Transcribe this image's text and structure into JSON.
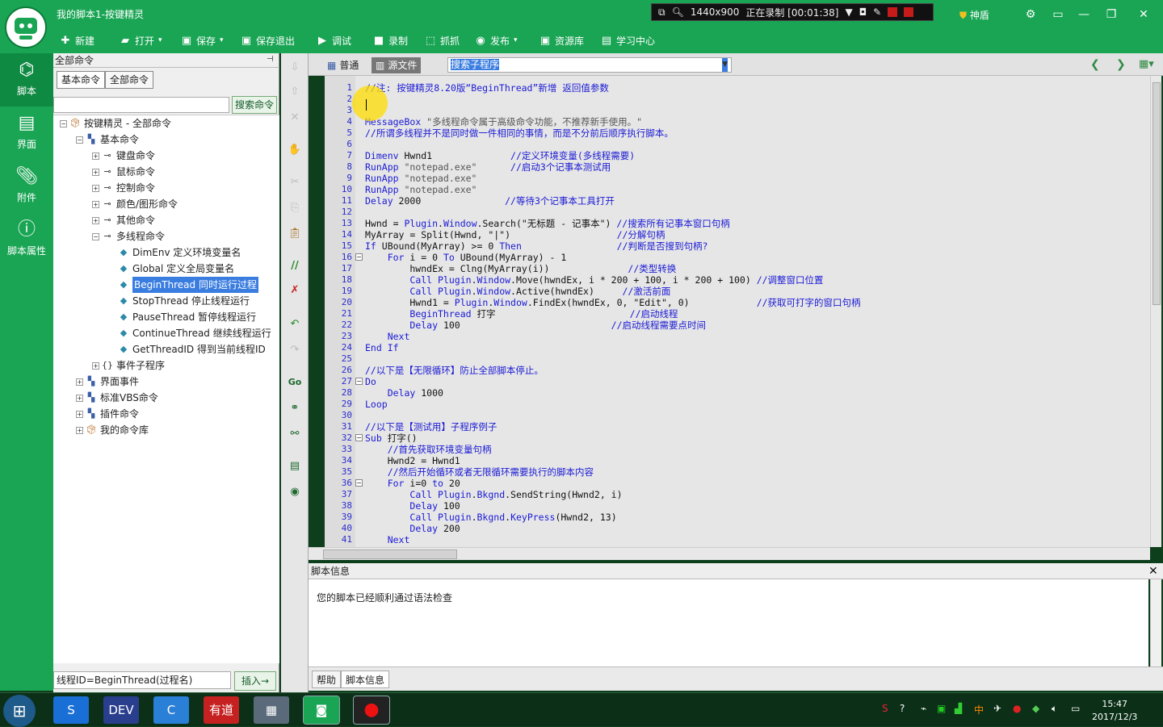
{
  "window": {
    "title": "我的脚本1-按键精灵"
  },
  "toolbar": [
    {
      "label": "新建",
      "icon": "plus-icon"
    },
    {
      "label": "打开",
      "icon": "folder-icon"
    },
    {
      "label": "保存",
      "icon": "save-icon"
    },
    {
      "label": "保存退出",
      "icon": "save-exit-icon"
    },
    {
      "label": "调试",
      "icon": "play-icon"
    },
    {
      "label": "录制",
      "icon": "camera-icon"
    },
    {
      "label": "抓抓",
      "icon": "grab-icon"
    },
    {
      "label": "发布",
      "icon": "publish-icon"
    },
    {
      "label": "资源库",
      "icon": "library-icon"
    },
    {
      "label": "学习中心",
      "icon": "book-icon"
    }
  ],
  "recorder": {
    "size": "1440x900",
    "status": "正在录制 [00:01:38]"
  },
  "shield": {
    "label": "神盾"
  },
  "leftbar": [
    {
      "label": "脚本",
      "icon": "script-icon"
    },
    {
      "label": "界面",
      "icon": "ui-icon"
    },
    {
      "label": "附件",
      "icon": "attachment-icon"
    },
    {
      "label": "脚本属性",
      "icon": "info-icon"
    }
  ],
  "panel": {
    "title": "全部命令",
    "tabs": [
      "基本命令",
      "全部命令"
    ],
    "search_button": "搜索命令",
    "tree": [
      {
        "label": "按键精灵 - 全部命令",
        "level": 0,
        "exp": "-",
        "icon": "root"
      },
      {
        "label": "基本命令",
        "level": 1,
        "exp": "-",
        "icon": "group"
      },
      {
        "label": "键盘命令",
        "level": 2,
        "exp": "+",
        "icon": "link"
      },
      {
        "label": "鼠标命令",
        "level": 2,
        "exp": "+",
        "icon": "link"
      },
      {
        "label": "控制命令",
        "level": 2,
        "exp": "+",
        "icon": "link"
      },
      {
        "label": "颜色/图形命令",
        "level": 2,
        "exp": "+",
        "icon": "link"
      },
      {
        "label": "其他命令",
        "level": 2,
        "exp": "+",
        "icon": "link"
      },
      {
        "label": "多线程命令",
        "level": 2,
        "exp": "-",
        "icon": "link"
      },
      {
        "label": "DimEnv 定义环境变量名",
        "level": 3,
        "icon": "gem"
      },
      {
        "label": "Global 定义全局变量名",
        "level": 3,
        "icon": "gem"
      },
      {
        "label": "BeginThread 同时运行过程",
        "level": 3,
        "icon": "gem",
        "selected": true
      },
      {
        "label": "StopThread 停止线程运行",
        "level": 3,
        "icon": "gem"
      },
      {
        "label": "PauseThread 暂停线程运行",
        "level": 3,
        "icon": "gem"
      },
      {
        "label": "ContinueThread 继续线程运行",
        "level": 3,
        "icon": "gem"
      },
      {
        "label": "GetThreadID 得到当前线程ID",
        "level": 3,
        "icon": "gem"
      },
      {
        "label": "事件子程序",
        "level": 2,
        "exp": "+",
        "icon": "brace"
      },
      {
        "label": "界面事件",
        "level": 1,
        "exp": "+",
        "icon": "group"
      },
      {
        "label": "标准VBS命令",
        "level": 1,
        "exp": "+",
        "icon": "group"
      },
      {
        "label": "插件命令",
        "level": 1,
        "exp": "+",
        "icon": "group"
      },
      {
        "label": "我的命令库",
        "level": 1,
        "exp": "+",
        "icon": "root"
      }
    ],
    "syntax_line": "线程ID=BeginThread(过程名)",
    "insert_button": "插入→"
  },
  "editor": {
    "tabs": [
      "普通",
      "源文件"
    ],
    "sub_search": "搜索子程序",
    "lines": [
      [
        {
          "t": "//注: 按键精灵8.20版“BeginThread”新增 返回值参数",
          "c": "cm"
        }
      ],
      [
        {
          "t": "",
          "c": ""
        }
      ],
      [
        {
          "t": "",
          "c": ""
        }
      ],
      [
        {
          "t": "MessageBox",
          "c": "kw"
        },
        {
          "t": " \"多线程命令属于高级命令功能，不推荐新手使用。\"",
          "c": "st"
        }
      ],
      [
        {
          "t": "//所谓多线程并不是同时做一件相同的事情，而是不分前后顺序执行脚本。",
          "c": "cm"
        }
      ],
      [
        {
          "t": "",
          "c": ""
        }
      ],
      [
        {
          "t": "Dimenv",
          "c": "kw"
        },
        {
          "t": " Hwnd1              ",
          "c": ""
        },
        {
          "t": "//定义环境变量(多线程需要)",
          "c": "cm"
        }
      ],
      [
        {
          "t": "RunApp",
          "c": "kw"
        },
        {
          "t": " \"notepad.exe\"      ",
          "c": "st"
        },
        {
          "t": "//启动3个记事本测试用",
          "c": "cm"
        }
      ],
      [
        {
          "t": "RunApp",
          "c": "kw"
        },
        {
          "t": " \"notepad.exe\"",
          "c": "st"
        }
      ],
      [
        {
          "t": "RunApp",
          "c": "kw"
        },
        {
          "t": " \"notepad.exe\"",
          "c": "st"
        }
      ],
      [
        {
          "t": "Delay",
          "c": "kw"
        },
        {
          "t": " 2000               ",
          "c": ""
        },
        {
          "t": "//等待3个记事本工具打开",
          "c": "cm"
        }
      ],
      [
        {
          "t": "",
          "c": ""
        }
      ],
      [
        {
          "t": "Hwnd = ",
          "c": ""
        },
        {
          "t": "Plugin",
          "c": "kw"
        },
        {
          "t": ".",
          "c": ""
        },
        {
          "t": "Window",
          "c": "kw"
        },
        {
          "t": ".Search(\"无标题 - 记事本\") ",
          "c": ""
        },
        {
          "t": "//搜索所有记事本窗口句柄",
          "c": "cm"
        }
      ],
      [
        {
          "t": "MyArray = Split(Hwnd, \"|\")                   ",
          "c": ""
        },
        {
          "t": "//分解句柄",
          "c": "cm"
        }
      ],
      [
        {
          "t": "If",
          "c": "kw"
        },
        {
          "t": " UBound(MyArray) >= 0 ",
          "c": ""
        },
        {
          "t": "Then",
          "c": "kw"
        },
        {
          "t": "                 ",
          "c": ""
        },
        {
          "t": "//判断是否搜到句柄?",
          "c": "cm"
        }
      ],
      [
        {
          "t": "    ",
          "c": ""
        },
        {
          "t": "For",
          "c": "kw"
        },
        {
          "t": " i = 0 ",
          "c": ""
        },
        {
          "t": "To",
          "c": "kw"
        },
        {
          "t": " UBound(MyArray) - 1",
          "c": ""
        }
      ],
      [
        {
          "t": "        hwndEx = Clng(MyArray(i))              ",
          "c": ""
        },
        {
          "t": "//类型转换",
          "c": "cm"
        }
      ],
      [
        {
          "t": "        ",
          "c": ""
        },
        {
          "t": "Call Plugin",
          "c": "kw"
        },
        {
          "t": ".",
          "c": ""
        },
        {
          "t": "Window",
          "c": "kw"
        },
        {
          "t": ".Move(hwndEx, i * 200 + 100, i * 200 + 100) ",
          "c": ""
        },
        {
          "t": "//调整窗口位置",
          "c": "cm"
        }
      ],
      [
        {
          "t": "        ",
          "c": ""
        },
        {
          "t": "Call Plugin",
          "c": "kw"
        },
        {
          "t": ".",
          "c": ""
        },
        {
          "t": "Window",
          "c": "kw"
        },
        {
          "t": ".Active(hwndEx)     ",
          "c": ""
        },
        {
          "t": "//激活前面",
          "c": "cm"
        }
      ],
      [
        {
          "t": "        Hwnd1 = ",
          "c": ""
        },
        {
          "t": "Plugin",
          "c": "kw"
        },
        {
          "t": ".",
          "c": ""
        },
        {
          "t": "Window",
          "c": "kw"
        },
        {
          "t": ".FindEx(hwndEx, 0, \"Edit\", 0)            ",
          "c": ""
        },
        {
          "t": "//获取可打字的窗口句柄",
          "c": "cm"
        }
      ],
      [
        {
          "t": "        ",
          "c": ""
        },
        {
          "t": "BeginThread",
          "c": "kw"
        },
        {
          "t": " 打字                        ",
          "c": ""
        },
        {
          "t": "//启动线程",
          "c": "cm"
        }
      ],
      [
        {
          "t": "        ",
          "c": ""
        },
        {
          "t": "Delay",
          "c": "kw"
        },
        {
          "t": " 100                           ",
          "c": ""
        },
        {
          "t": "//启动线程需要点时间",
          "c": "cm"
        }
      ],
      [
        {
          "t": "    ",
          "c": ""
        },
        {
          "t": "Next",
          "c": "kw"
        }
      ],
      [
        {
          "t": "End If",
          "c": "kw"
        }
      ],
      [
        {
          "t": "",
          "c": ""
        }
      ],
      [
        {
          "t": "//以下是【无限循环】防止全部脚本停止。",
          "c": "cm"
        }
      ],
      [
        {
          "t": "Do",
          "c": "kw"
        }
      ],
      [
        {
          "t": "    ",
          "c": ""
        },
        {
          "t": "Delay",
          "c": "kw"
        },
        {
          "t": " 1000",
          "c": ""
        }
      ],
      [
        {
          "t": "Loop",
          "c": "kw"
        }
      ],
      [
        {
          "t": "",
          "c": ""
        }
      ],
      [
        {
          "t": "//以下是【测试用】子程序例子",
          "c": "cm"
        }
      ],
      [
        {
          "t": "Sub",
          "c": "kw"
        },
        {
          "t": " 打字()",
          "c": ""
        }
      ],
      [
        {
          "t": "    ",
          "c": ""
        },
        {
          "t": "//首先获取环境变量句柄",
          "c": "cm"
        }
      ],
      [
        {
          "t": "    Hwnd2 = Hwnd1",
          "c": ""
        }
      ],
      [
        {
          "t": "    ",
          "c": ""
        },
        {
          "t": "//然后开始循环或者无限循环需要执行的脚本内容",
          "c": "cm"
        }
      ],
      [
        {
          "t": "    ",
          "c": ""
        },
        {
          "t": "For",
          "c": "kw"
        },
        {
          "t": " i=0 ",
          "c": ""
        },
        {
          "t": "to",
          "c": "kw"
        },
        {
          "t": " 20",
          "c": ""
        }
      ],
      [
        {
          "t": "        ",
          "c": ""
        },
        {
          "t": "Call Plugin",
          "c": "kw"
        },
        {
          "t": ".",
          "c": ""
        },
        {
          "t": "Bkgnd",
          "c": "kw"
        },
        {
          "t": ".SendString(Hwnd2, i)",
          "c": ""
        }
      ],
      [
        {
          "t": "        ",
          "c": ""
        },
        {
          "t": "Delay",
          "c": "kw"
        },
        {
          "t": " 100",
          "c": ""
        }
      ],
      [
        {
          "t": "        ",
          "c": ""
        },
        {
          "t": "Call Plugin",
          "c": "kw"
        },
        {
          "t": ".",
          "c": ""
        },
        {
          "t": "Bkgnd",
          "c": "kw"
        },
        {
          "t": ".",
          "c": ""
        },
        {
          "t": "KeyPress",
          "c": "kw"
        },
        {
          "t": "(Hwnd2, 13)",
          "c": ""
        }
      ],
      [
        {
          "t": "        ",
          "c": ""
        },
        {
          "t": "Delay",
          "c": "kw"
        },
        {
          "t": " 200",
          "c": ""
        }
      ],
      [
        {
          "t": "    ",
          "c": ""
        },
        {
          "t": "Next",
          "c": "kw"
        }
      ],
      [
        {
          "t": "End Sub",
          "c": "kw"
        }
      ]
    ],
    "fold_lines": [
      16,
      27,
      32,
      36
    ]
  },
  "info": {
    "title": "脚本信息",
    "message": "您的脚本已经顺利通过语法检查",
    "tabs": [
      "帮助",
      "脚本信息"
    ]
  },
  "taskbar": {
    "apps": [
      {
        "name": "sogou",
        "text": "S",
        "color": "#1a6fd6"
      },
      {
        "name": "devexpress",
        "text": "DEV",
        "color": "#2a3e8e"
      },
      {
        "name": "app-c",
        "text": "C",
        "color": "#2a7fd6"
      },
      {
        "name": "youdao",
        "text": "有道",
        "color": "#c62121"
      },
      {
        "name": "calculator",
        "text": "▦",
        "color": "#5a6a7a"
      },
      {
        "name": "anjian",
        "text": "◙",
        "color": "#1aa554"
      },
      {
        "name": "recorder",
        "text": "●",
        "color": "#222"
      }
    ],
    "time": "15:47",
    "date": "2017/12/3"
  }
}
